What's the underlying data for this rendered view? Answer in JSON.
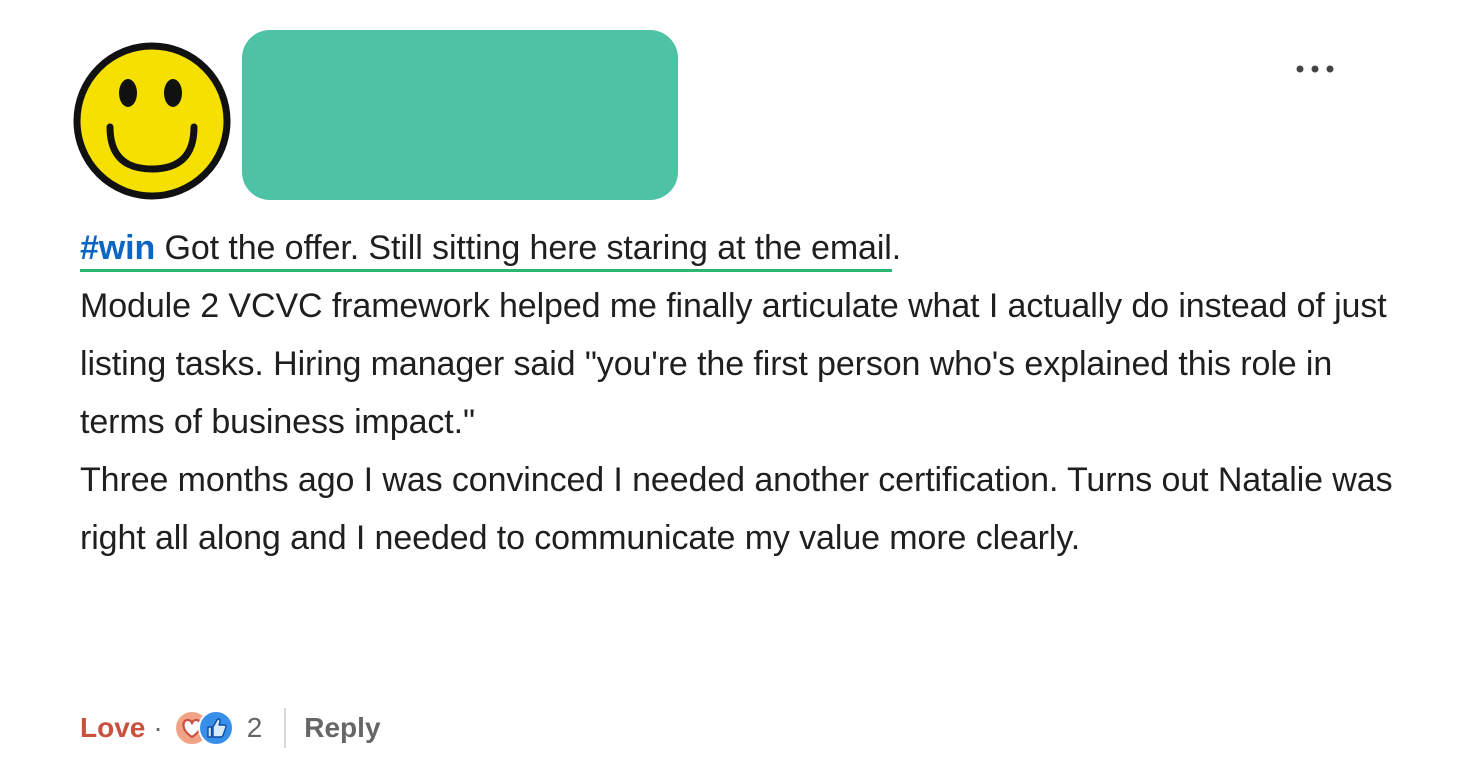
{
  "post": {
    "hashtag": "#win",
    "first_line_text": " Got the offer. Still sitting here staring at the email",
    "first_line_end": ".",
    "paragraph_2": "Module 2 VCVC framework helped me finally articulate what I actually do instead of just listing tasks. Hiring manager said \"you're the first person who's explained this role in terms of business impact.\"",
    "paragraph_3": "Three months ago I was convinced I needed another certification. Turns out Natalie was right all along and I needed to communicate my value more clearly."
  },
  "actions": {
    "reaction_label": "Love",
    "separator": "·",
    "reaction_count": "2",
    "reply_label": "Reply"
  },
  "colors": {
    "hashtag": "#0a66c2",
    "highlight_underline": "#2bb673",
    "name_redaction": "#4dc2a5",
    "love": "#c9513d",
    "avatar_face": "#f6e000"
  },
  "icons": {
    "avatar": "smiley-face-icon",
    "more": "more-options-icon",
    "reactions": [
      "love-reaction-icon",
      "like-reaction-icon"
    ]
  }
}
